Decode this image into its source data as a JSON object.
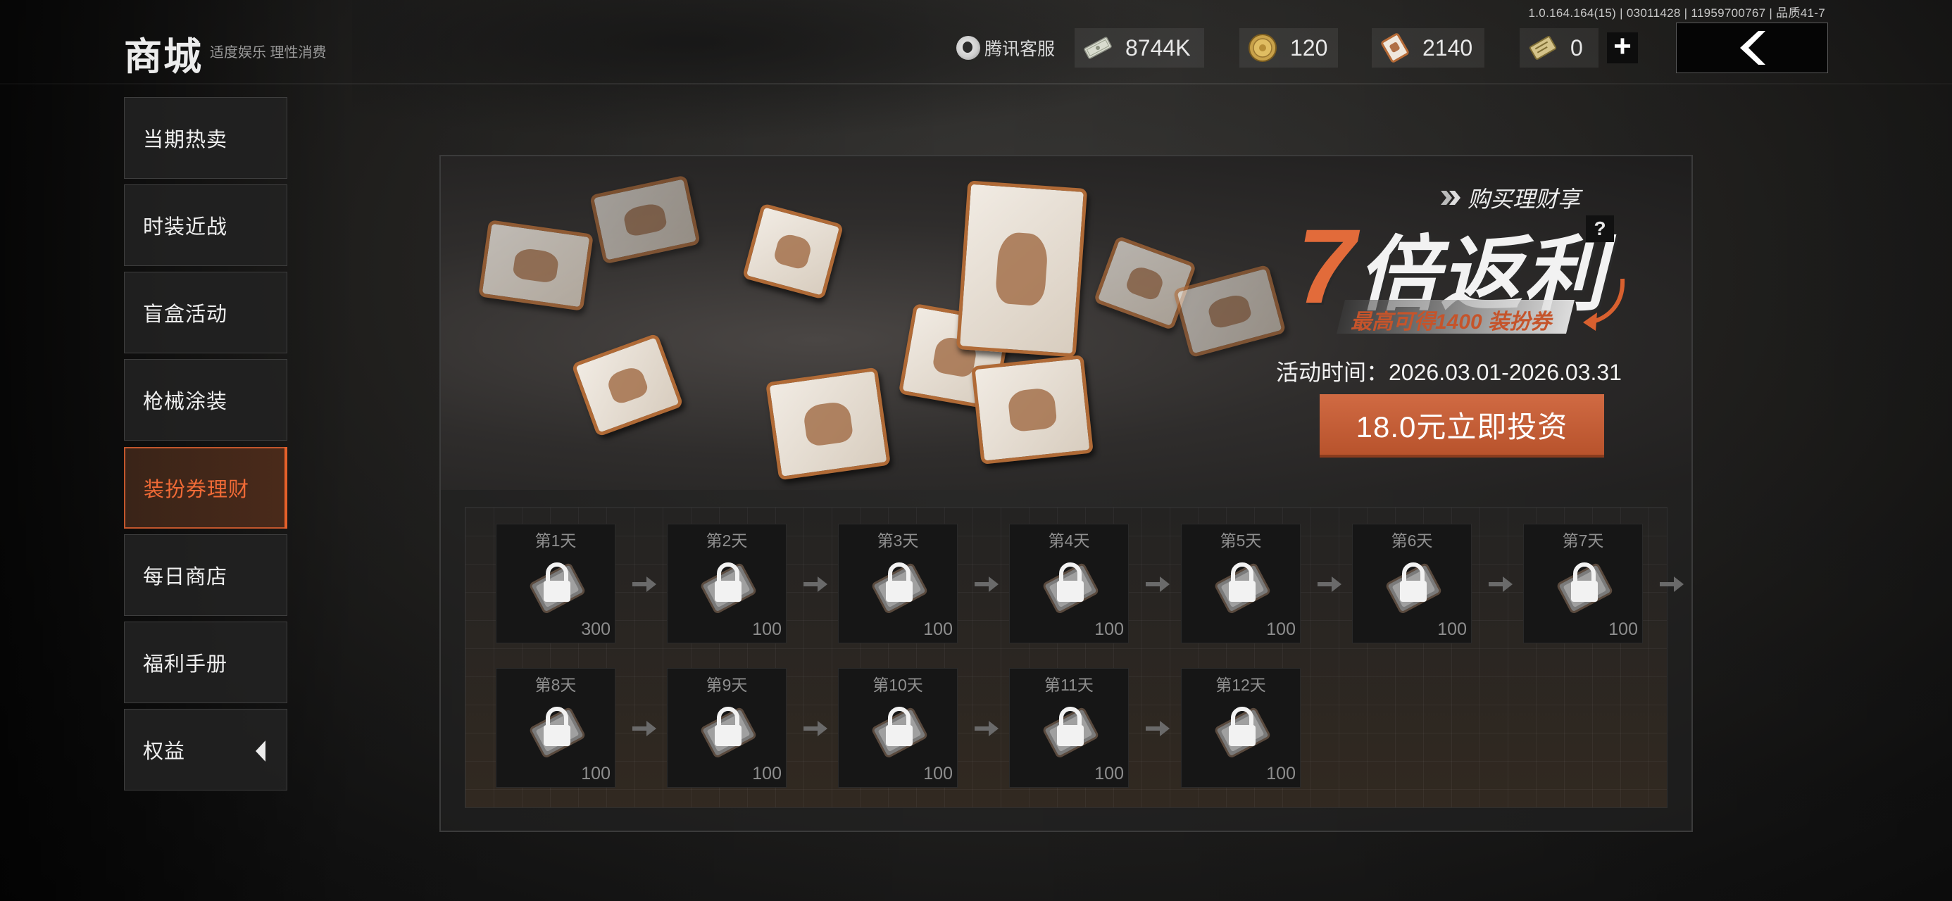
{
  "version_info": "1.0.164.164(15) | 03011428 | 11959700767 | 品质41-7",
  "header": {
    "title": "商城",
    "subtitle": "适度娱乐 理性消费",
    "service_label": "腾讯客服",
    "currencies": [
      {
        "icon": "cash-icon",
        "amount": "8744K"
      },
      {
        "icon": "gold-coin-icon",
        "amount": "120"
      },
      {
        "icon": "voucher-icon",
        "amount": "2140"
      },
      {
        "icon": "ticket-icon",
        "amount": "0"
      }
    ],
    "add_label": "+",
    "back_icon": "chevron-left-icon"
  },
  "sidebar": {
    "items": [
      {
        "label": "当期热卖",
        "active": false
      },
      {
        "label": "时装近战",
        "active": false
      },
      {
        "label": "盲盒活动",
        "active": false
      },
      {
        "label": "枪械涂装",
        "active": false
      },
      {
        "label": "装扮券理财",
        "active": true
      },
      {
        "label": "每日商店",
        "active": false
      },
      {
        "label": "福利手册",
        "active": false
      },
      {
        "label": "权益",
        "active": false
      }
    ]
  },
  "banner": {
    "tagline": "购买理财享",
    "headline_number": "7",
    "headline_text": "倍返利",
    "help_label": "?",
    "sub_headline": "最高可得1400 装扮券",
    "event_time": "活动时间：2026.03.01-2026.03.31",
    "invest_button": "18.0元立即投资"
  },
  "days": [
    {
      "label": "第1天",
      "amount": "300"
    },
    {
      "label": "第2天",
      "amount": "100"
    },
    {
      "label": "第3天",
      "amount": "100"
    },
    {
      "label": "第4天",
      "amount": "100"
    },
    {
      "label": "第5天",
      "amount": "100"
    },
    {
      "label": "第6天",
      "amount": "100"
    },
    {
      "label": "第7天",
      "amount": "100"
    },
    {
      "label": "第8天",
      "amount": "100"
    },
    {
      "label": "第9天",
      "amount": "100"
    },
    {
      "label": "第10天",
      "amount": "100"
    },
    {
      "label": "第11天",
      "amount": "100"
    },
    {
      "label": "第12天",
      "amount": "100"
    }
  ],
  "colors": {
    "accent": "#e5602a",
    "invest_button": "#c05c36",
    "panel_bg": "#242322"
  }
}
